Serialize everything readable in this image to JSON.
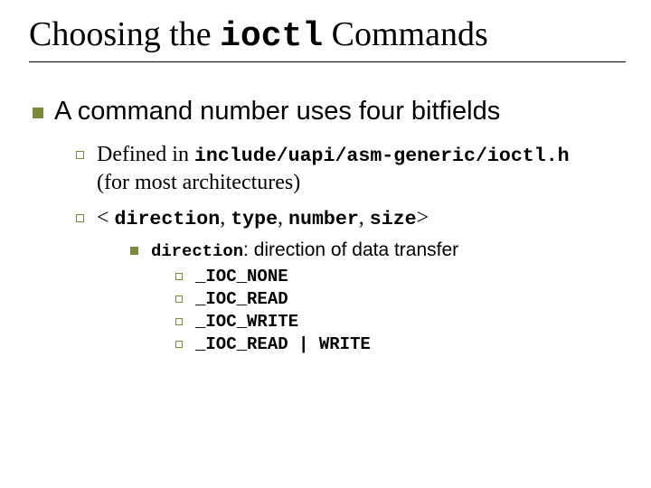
{
  "title_pre": "Choosing the ",
  "title_code": "ioctl",
  "title_post": " Commands",
  "l1": "A command number uses four bitfields",
  "l2a_pre": "Defined in ",
  "l2a_code": "include/uapi/asm-generic/ioctl.h",
  "l2a_post": "(for most architectures)",
  "l2b_open": "< ",
  "l2b_dir": "direction",
  "l2b_c1": ", ",
  "l2b_type": "type",
  "l2b_c2": ", ",
  "l2b_num": "number",
  "l2b_c3": ", ",
  "l2b_size": "size",
  "l2b_close": ">",
  "l3_code": "direction",
  "l3_post": ": direction of data transfer",
  "l4_1": "_IOC_NONE",
  "l4_2": "_IOC_READ",
  "l4_3": "_IOC_WRITE",
  "l4_4": "_IOC_READ | WRITE"
}
